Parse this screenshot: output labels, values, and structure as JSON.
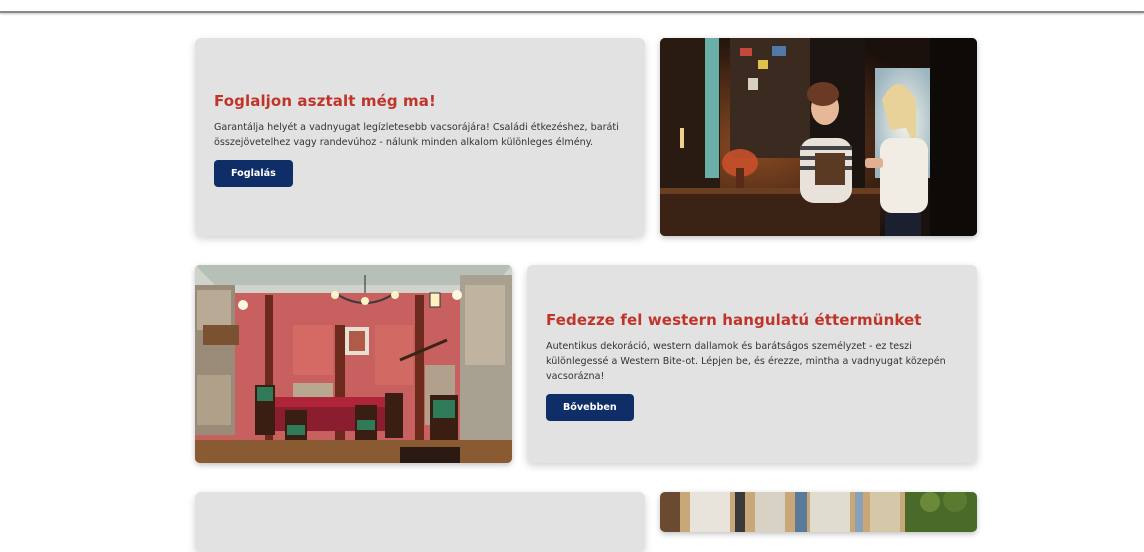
{
  "sections": [
    {
      "title": "Foglaljon asztalt még ma!",
      "text": "Garantálja helyét a vadnyugat legízletesebb vacsorájára! Családi étkezéshez, baráti összejövetelhez vagy randevúhoz - nálunk minden alkalom különleges élmény.",
      "button": "Foglalás"
    },
    {
      "title": "Fedezze fel western hangulatú éttermünket",
      "text": "Autentikus dekoráció, western dallamok és barátságos személyzet - ez teszi különlegessé a Western Bite-ot. Lépjen be, és érezze, mintha a vadnyugat közepén vacsorázna!",
      "button": "Bővebben"
    }
  ],
  "colors": {
    "accent": "#c0342a",
    "button": "#0f2e68",
    "card": "#e2e2e2"
  }
}
